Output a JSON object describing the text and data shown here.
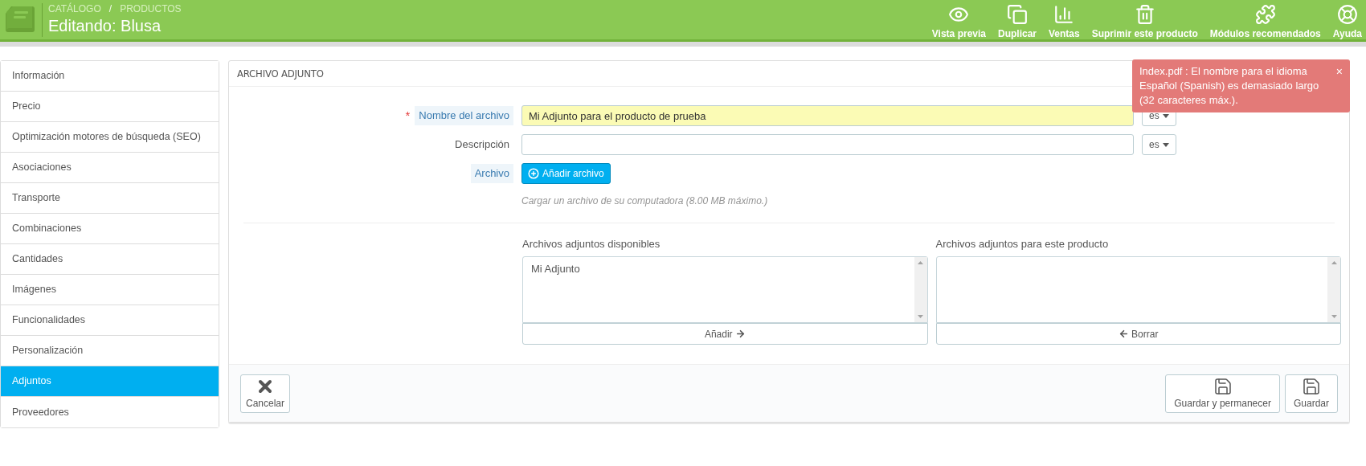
{
  "header": {
    "breadcrumb": [
      "CATÁLOGO",
      "PRODUCTOS"
    ],
    "separator": "/",
    "title": "Editando: Blusa",
    "actions": [
      {
        "label": "Vista previa"
      },
      {
        "label": "Duplicar"
      },
      {
        "label": "Ventas"
      },
      {
        "label": "Suprimir este producto"
      },
      {
        "label": "Módulos recomendados"
      },
      {
        "label": "Ayuda"
      }
    ]
  },
  "sidebar": {
    "items": [
      {
        "label": "Información",
        "selected": false
      },
      {
        "label": "Precio",
        "selected": false
      },
      {
        "label": "Optimización motores de búsqueda (SEO)",
        "selected": false
      },
      {
        "label": "Asociaciones",
        "selected": false
      },
      {
        "label": "Transporte",
        "selected": false
      },
      {
        "label": "Combinaciones",
        "selected": false
      },
      {
        "label": "Cantidades",
        "selected": false
      },
      {
        "label": "Imágenes",
        "selected": false
      },
      {
        "label": "Funcionalidades",
        "selected": false
      },
      {
        "label": "Personalización",
        "selected": false
      },
      {
        "label": "Adjuntos",
        "selected": true
      },
      {
        "label": "Proveedores",
        "selected": false
      }
    ]
  },
  "panel": {
    "title": "ARCHIVO ADJUNTO",
    "fields": [
      {
        "kind": "text",
        "marker": "*",
        "label": "Nombre del archivo",
        "hint": true,
        "value": "Mi Adjunto para el producto de prueba",
        "highlighted": true,
        "lang": "es"
      },
      {
        "kind": "text",
        "label": "Descripción",
        "hint": false,
        "highlighted": false,
        "lang": "es"
      },
      {
        "kind": "file",
        "label": "Archivo",
        "hint": true,
        "button": "Añadir archivo",
        "help": "Cargar un archivo de su computadora (8.00 MB máximo.)"
      }
    ],
    "lists": [
      {
        "label": "Archivos adjuntos disponibles",
        "items": [
          "Mi Adjunto"
        ],
        "button": "Añadir",
        "kind": "add"
      },
      {
        "label": "Archivos adjuntos para este producto",
        "button": "Borrar",
        "kind": "remove"
      }
    ],
    "footer": {
      "cancel": "Cancelar",
      "saves": [
        "Guardar y permanecer",
        "Guardar"
      ]
    }
  },
  "toast": {
    "text": "Index.pdf : El nombre para el idioma Español (Spanish) es demasiado largo (32 caracteres máx.).",
    "close": "×"
  }
}
